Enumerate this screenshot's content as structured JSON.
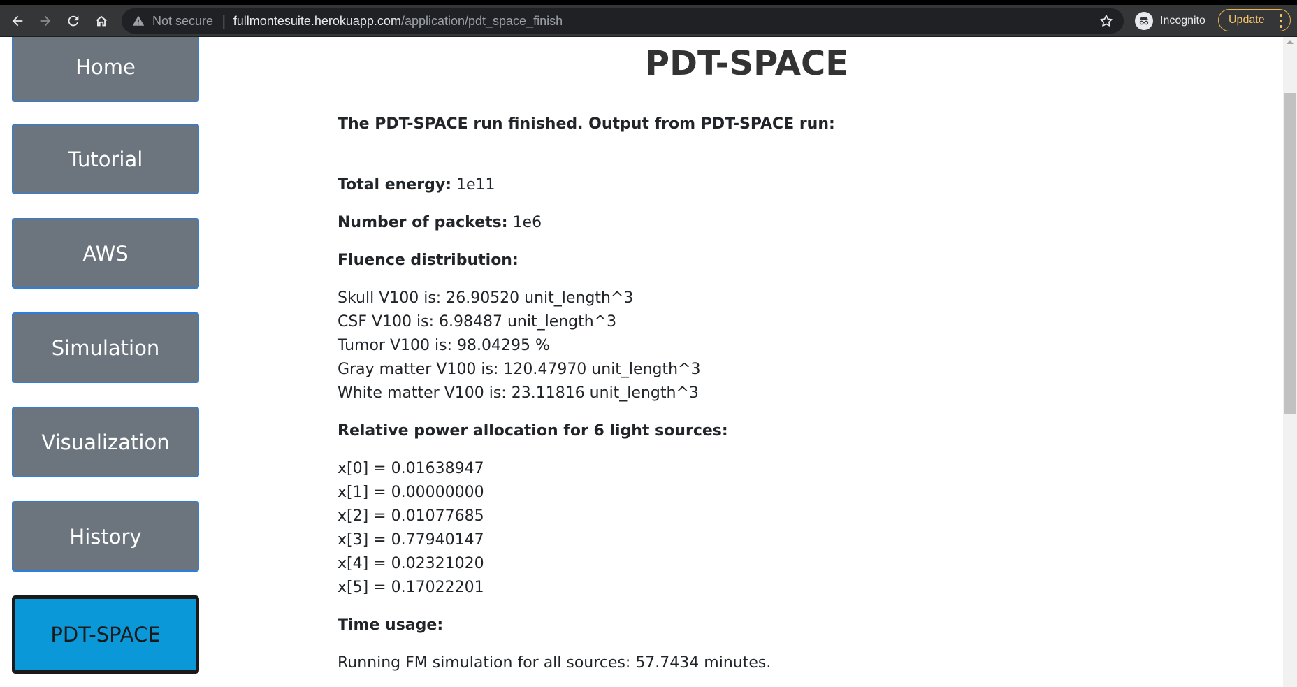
{
  "browser": {
    "security_label": "Not secure",
    "url_host": "fullmontesuite.herokuapp.com",
    "url_path": "/application/pdt_space_finish",
    "incognito_label": "Incognito",
    "update_label": "Update"
  },
  "sidebar": {
    "items": [
      {
        "label": "Home"
      },
      {
        "label": "Tutorial"
      },
      {
        "label": "AWS"
      },
      {
        "label": "Simulation"
      },
      {
        "label": "Visualization"
      },
      {
        "label": "History"
      },
      {
        "label": "PDT-SPACE"
      }
    ],
    "active": "PDT-SPACE"
  },
  "main": {
    "title": "PDT-SPACE",
    "intro": "The PDT-SPACE run finished. Output from PDT-SPACE run:",
    "total_energy_label": "Total energy:",
    "total_energy_value": "1e11",
    "packets_label": "Number of packets:",
    "packets_value": "1e6",
    "fluence_heading": "Fluence distribution:",
    "fluence_lines": [
      "Skull V100 is: 26.90520 unit_length^3",
      "CSF V100 is: 6.98487 unit_length^3",
      "Tumor V100 is: 98.04295 %",
      "Gray matter V100 is: 120.47970 unit_length^3",
      "White matter V100 is: 23.11816 unit_length^3"
    ],
    "power_heading": "Relative power allocation for 6 light sources:",
    "power_lines": [
      "x[0] = 0.01638947",
      "x[1] = 0.00000000",
      "x[2] = 0.01077685",
      "x[3] = 0.77940147",
      "x[4] = 0.02321020",
      "x[5] = 0.17022201"
    ],
    "time_heading": "Time usage:",
    "time_line": "Running FM simulation for all sources: 57.7434 minutes."
  },
  "colors": {
    "sidebar_button": "#6c757d",
    "sidebar_button_border": "#2f7fd8",
    "sidebar_active": "#0a98d8",
    "chrome_bg": "#353638",
    "update_accent": "#f7c46c"
  }
}
